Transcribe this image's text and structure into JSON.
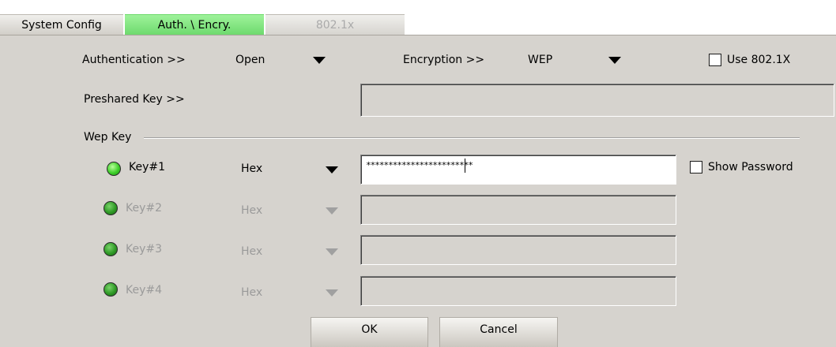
{
  "tabs": [
    {
      "label": "System Config",
      "state": "normal"
    },
    {
      "label": "Auth. \\ Encry.",
      "state": "active"
    },
    {
      "label": "802.1x",
      "state": "disabled"
    }
  ],
  "auth": {
    "label": "Authentication >>",
    "value": "Open"
  },
  "encryption": {
    "label": "Encryption >>",
    "value": "WEP"
  },
  "use8021x": {
    "label": "Use 802.1X",
    "checked": false
  },
  "preshared": {
    "label": "Preshared Key >>",
    "value": ""
  },
  "wep": {
    "group_label": "Wep Key",
    "show_password_label": "Show Password",
    "keys": [
      {
        "label": "Key#1",
        "format": "Hex",
        "value": "************************",
        "enabled": true,
        "selected": true
      },
      {
        "label": "Key#2",
        "format": "Hex",
        "value": "",
        "enabled": false,
        "selected": false
      },
      {
        "label": "Key#3",
        "format": "Hex",
        "value": "",
        "enabled": false,
        "selected": false
      },
      {
        "label": "Key#4",
        "format": "Hex",
        "value": "",
        "enabled": false,
        "selected": false
      }
    ]
  },
  "buttons": {
    "ok": "OK",
    "cancel": "Cancel"
  },
  "colors": {
    "active_tab": "#7ddf7a",
    "background": "#d6d3ce",
    "radio_on": "#3ecf2a"
  }
}
